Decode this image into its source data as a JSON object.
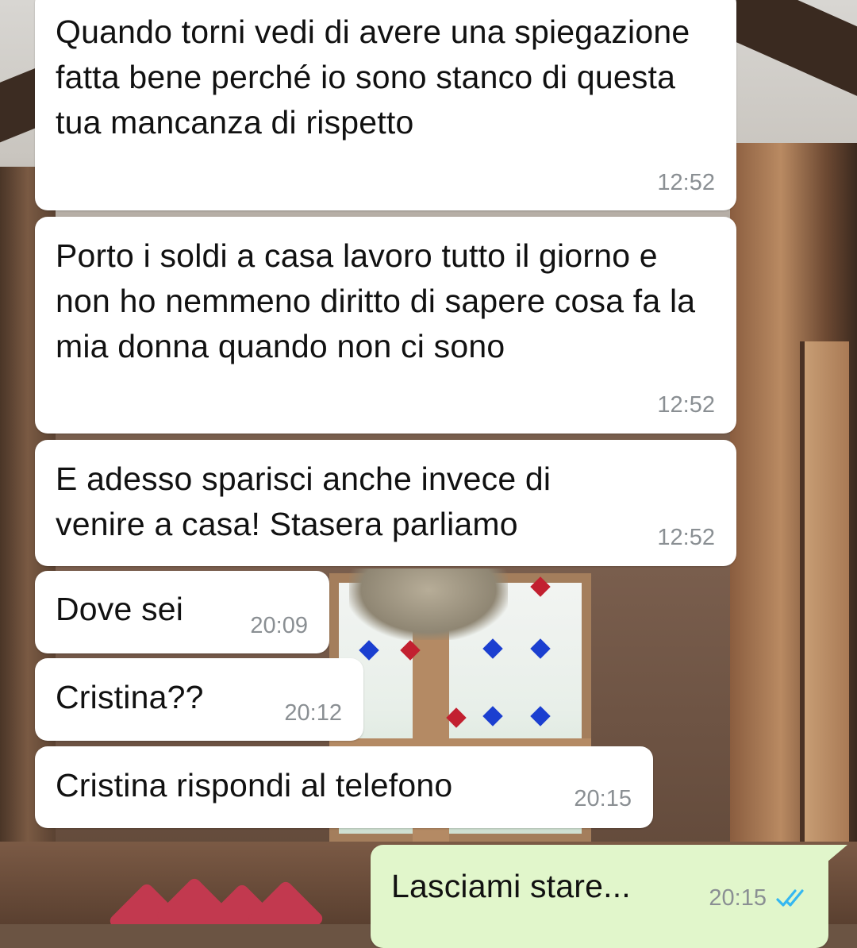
{
  "messages": [
    {
      "direction": "incoming",
      "text": "Quando torni vedi di avere una spiegazione fatta bene perché io sono stanco di questa tua mancanza di rispetto",
      "time": "12:52"
    },
    {
      "direction": "incoming",
      "text": "Porto i soldi a casa lavoro tutto il giorno e non ho nemmeno diritto di sapere cosa fa la mia donna quando non ci sono",
      "time": "12:52"
    },
    {
      "direction": "incoming",
      "text": "E adesso sparisci anche invece di venire a casa! Stasera parliamo",
      "time": "12:52"
    },
    {
      "direction": "incoming",
      "text": "Dove sei",
      "time": "20:09"
    },
    {
      "direction": "incoming",
      "text": "Cristina??",
      "time": "20:12"
    },
    {
      "direction": "incoming",
      "text": "Cristina rispondi al telefono",
      "time": "20:15"
    },
    {
      "direction": "outgoing",
      "text": "Lasciami stare...",
      "time": "20:15",
      "status": "read"
    }
  ],
  "colors": {
    "incoming_bubble": "#ffffff",
    "outgoing_bubble": "#e1f6cb",
    "timestamp": "#8a8f93",
    "read_ticks": "#34b7f1"
  },
  "icons": {
    "read_receipt": "double-check-icon"
  }
}
